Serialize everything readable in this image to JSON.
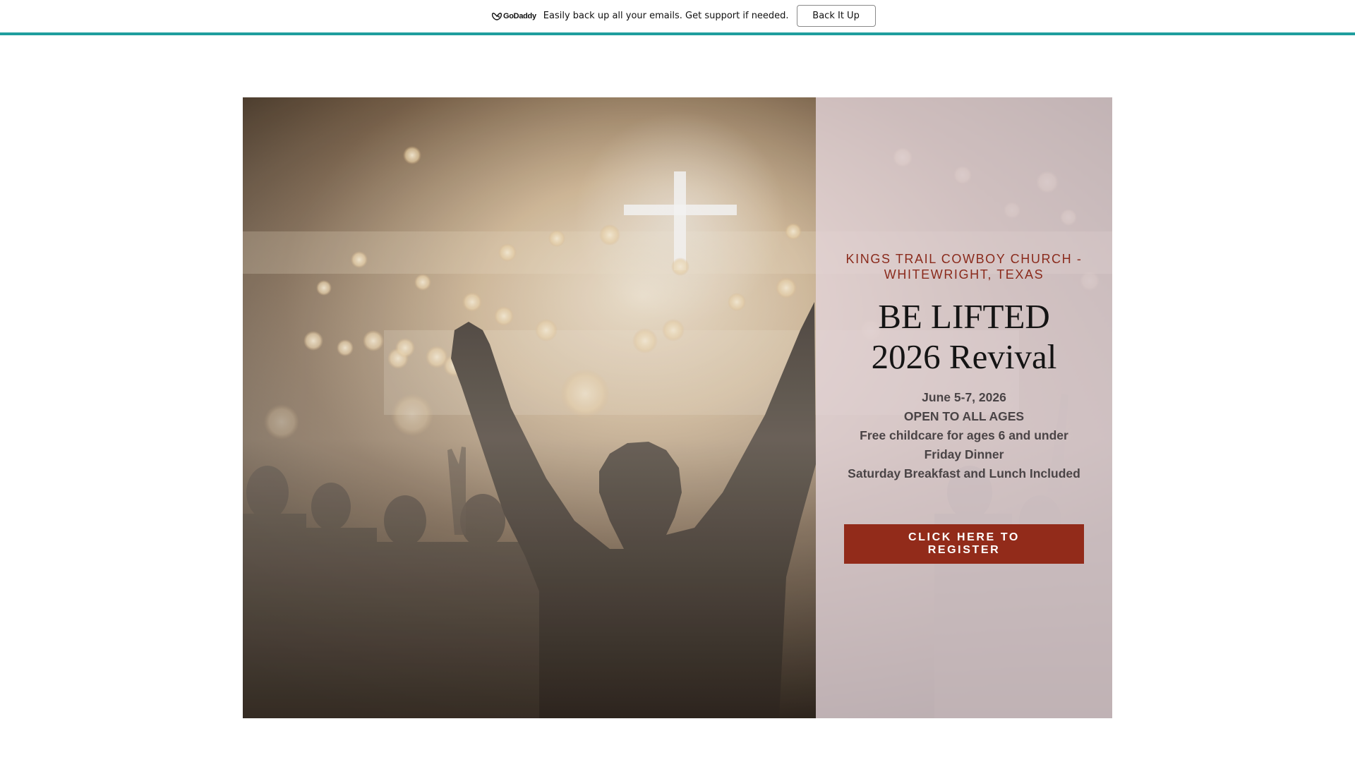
{
  "topbar": {
    "logo_text": "GoDaddy",
    "message": "Easily back up all your emails. Get support if needed.",
    "button_label": "Back It Up",
    "accent_color": "#1f9e9e"
  },
  "hero": {
    "church_name": "KINGS TRAIL COWBOY CHURCH - WHITEWRIGHT, TEXAS",
    "title_line1": "BE LIFTED",
    "title_line2": "2026 Revival",
    "details": [
      "June 5-7, 2026",
      "OPEN TO ALL AGES",
      "Free childcare for ages 6 and under",
      "Friday Dinner",
      "Saturday Breakfast and Lunch Included"
    ],
    "register_label": "CLICK HERE TO REGISTER",
    "accent_color": "#922b1a",
    "image_icon": "worship-crowd-photo"
  }
}
